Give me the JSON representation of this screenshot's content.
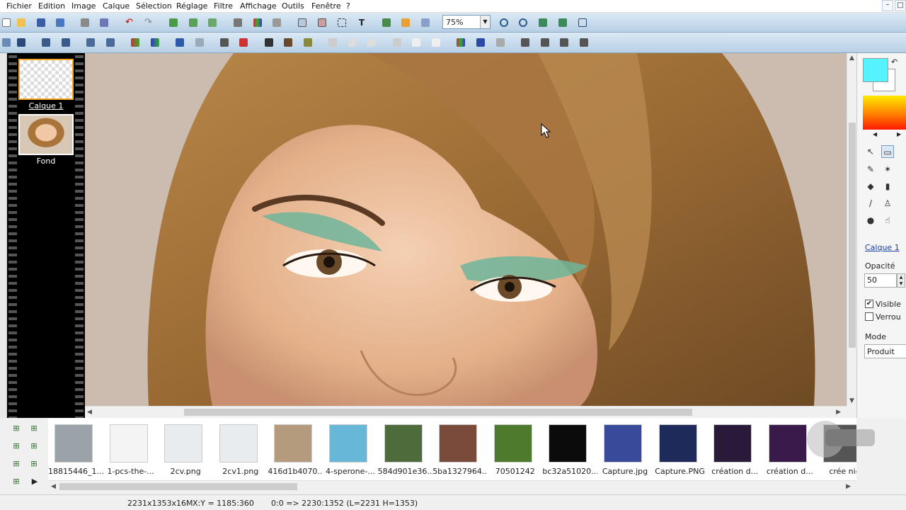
{
  "menu": {
    "items": [
      "Fichier",
      "Edition",
      "Image",
      "Calque",
      "Sélection",
      "Réglage",
      "Filtre",
      "Affichage",
      "Outils",
      "Fenêtre",
      "?"
    ]
  },
  "window": {
    "minimize": "–",
    "close": "□"
  },
  "toolbar": {
    "zoom": "75%",
    "zoom_arrow": "▼"
  },
  "layers": [
    {
      "label": "Calque 1",
      "selected": true
    },
    {
      "label": "Fond",
      "selected": false
    }
  ],
  "canvas": {
    "image": "portrait-woman-green-eyeshadow"
  },
  "right_panel": {
    "layer_name": "Calque 1",
    "opacity_label": "Opacité",
    "opacity_value": "50",
    "visible_label": "Visible",
    "visible_checked": true,
    "lock_label": "Verrou",
    "lock_checked": false,
    "mode_label": "Mode",
    "mode_value": "Produit",
    "fg_color": "#55f2ff",
    "bg_color": "#ffffff"
  },
  "browser": {
    "files": [
      {
        "name": "18815446_1...",
        "color": "#9aa3a8"
      },
      {
        "name": "1-pcs-the-...",
        "color": "#f4f4f4"
      },
      {
        "name": "2cv.png",
        "color": "#e9ecee"
      },
      {
        "name": "2cv1.png",
        "color": "#e9ecee"
      },
      {
        "name": "416d1b4070...",
        "color": "#b59b7e"
      },
      {
        "name": "4-sperone-...",
        "color": "#67b7d8"
      },
      {
        "name": "584d901e36...",
        "color": "#4e6b3c"
      },
      {
        "name": "5ba1327964...",
        "color": "#7a4b3a"
      },
      {
        "name": "70501242",
        "color": "#4e7a2c"
      },
      {
        "name": "bc32a51020...",
        "color": "#0b0b0b"
      },
      {
        "name": "Capture.jpg",
        "color": "#3a4a9a"
      },
      {
        "name": "Capture.PNG",
        "color": "#1d2a5a"
      },
      {
        "name": "création d...",
        "color": "#2a1a3a"
      },
      {
        "name": "création d...",
        "color": "#3a1a4a"
      },
      {
        "name": "crée nie",
        "color": "#555555"
      }
    ]
  },
  "status": {
    "dimensions": "2231x1353x16M",
    "coords": "X:Y = 1185:360",
    "selection": "0:0 => 2230:1352 (L=2231  H=1353)"
  }
}
